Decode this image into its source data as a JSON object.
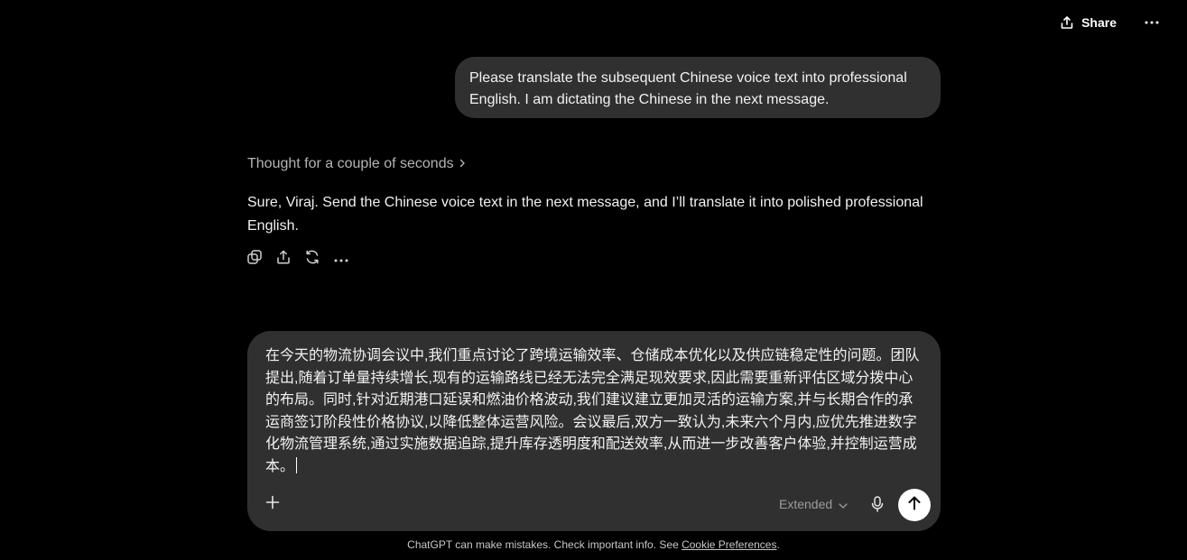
{
  "header": {
    "share_label": "Share"
  },
  "user_message": {
    "text": "Please translate the subsequent Chinese voice text into professional English. I am dictating the Chinese in the next message."
  },
  "assistant": {
    "thought_label": "Thought for a couple of seconds",
    "message": "Sure, Viraj. Send the Chinese voice text in the next message, and I’ll translate it into polished professional English."
  },
  "composer": {
    "text": "在今天的物流协调会议中,我们重点讨论了跨境运输效率、仓储成本优化以及供应链稳定性的问题。团队提出,随着订单量持续增长,现有的运输路线已经无法完全满足现效要求,因此需要重新评估区域分拨中心的布局。同时,针对近期港口延误和燃油价格波动,我们建议建立更加灵活的运输方案,并与长期合作的承运商签订阶段性价格协议,以降低整体运营风险。会议最后,双方一致认为,未来六个月内,应优先推进数字化物流管理系统,通过实施数据追踪,提升库存透明度和配送效率,从而进一步改善客户体验,并控制运营成本。",
    "model_label": "Extended"
  },
  "footer": {
    "text": "ChatGPT can make mistakes. Check important info. See ",
    "link": "Cookie Preferences",
    "suffix": "."
  },
  "icons": [
    "share-icon",
    "more-icon",
    "chevron-right-icon",
    "copy-icon",
    "share-icon",
    "regenerate-icon",
    "more-icon",
    "plus-icon",
    "chevron-down-icon",
    "mic-icon",
    "arrow-up-icon"
  ]
}
